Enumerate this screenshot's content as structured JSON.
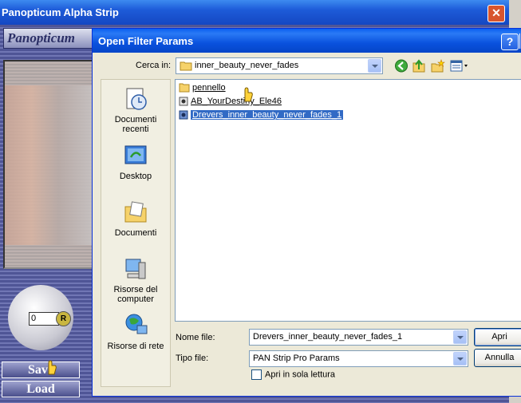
{
  "background_window": {
    "title": "Panopticum Alpha Strip",
    "close_glyph": "✕",
    "logo_text": "Panopticum",
    "knob_value": "0",
    "knob_reset_glyph": "R",
    "save_label": "Save",
    "load_label": "Load"
  },
  "dialog": {
    "title": "Open Filter Params",
    "help_glyph": "?",
    "lookin_label": "Cerca in:",
    "lookin_value": "inner_beauty_never_fades",
    "toolbar": [
      "back-icon",
      "up-folder-icon",
      "new-folder-icon",
      "views-menu-icon"
    ],
    "places": [
      {
        "label1": "Documenti",
        "label2": "recenti",
        "icon": "recent-documents-icon"
      },
      {
        "label1": "Desktop",
        "label2": "",
        "icon": "desktop-icon"
      },
      {
        "label1": "Documenti",
        "label2": "",
        "icon": "my-documents-icon"
      },
      {
        "label1": "Risorse del",
        "label2": "computer",
        "icon": "my-computer-icon"
      },
      {
        "label1": "Risorse di rete",
        "label2": "",
        "icon": "network-icon"
      }
    ],
    "files": [
      {
        "name": "pennello",
        "type": "folder",
        "selected": false
      },
      {
        "name": "AB_YourDestiny_Ele46",
        "type": "file",
        "selected": false
      },
      {
        "name": "Drevers_inner_beauty_never_fades_1",
        "type": "file",
        "selected": true
      }
    ],
    "filename_label": "Nome file:",
    "filename_value": "Drevers_inner_beauty_never_fades_1",
    "filetype_label": "Tipo file:",
    "filetype_value": "PAN Strip Pro Params",
    "open_button": "Apri",
    "cancel_button": "Annulla",
    "readonly_label": "Apri in sola lettura",
    "readonly_checked": false
  }
}
